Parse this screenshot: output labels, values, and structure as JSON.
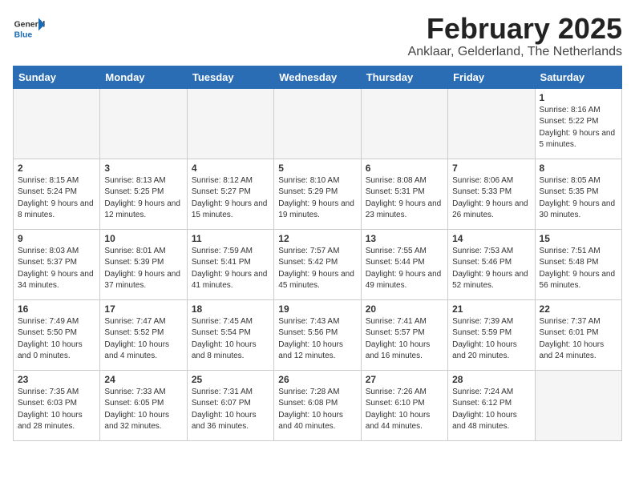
{
  "header": {
    "logo_general": "General",
    "logo_blue": "Blue",
    "month": "February 2025",
    "location": "Anklaar, Gelderland, The Netherlands"
  },
  "weekdays": [
    "Sunday",
    "Monday",
    "Tuesday",
    "Wednesday",
    "Thursday",
    "Friday",
    "Saturday"
  ],
  "weeks": [
    [
      {
        "day": "",
        "info": ""
      },
      {
        "day": "",
        "info": ""
      },
      {
        "day": "",
        "info": ""
      },
      {
        "day": "",
        "info": ""
      },
      {
        "day": "",
        "info": ""
      },
      {
        "day": "",
        "info": ""
      },
      {
        "day": "1",
        "info": "Sunrise: 8:16 AM\nSunset: 5:22 PM\nDaylight: 9 hours and 5 minutes."
      }
    ],
    [
      {
        "day": "2",
        "info": "Sunrise: 8:15 AM\nSunset: 5:24 PM\nDaylight: 9 hours and 8 minutes."
      },
      {
        "day": "3",
        "info": "Sunrise: 8:13 AM\nSunset: 5:25 PM\nDaylight: 9 hours and 12 minutes."
      },
      {
        "day": "4",
        "info": "Sunrise: 8:12 AM\nSunset: 5:27 PM\nDaylight: 9 hours and 15 minutes."
      },
      {
        "day": "5",
        "info": "Sunrise: 8:10 AM\nSunset: 5:29 PM\nDaylight: 9 hours and 19 minutes."
      },
      {
        "day": "6",
        "info": "Sunrise: 8:08 AM\nSunset: 5:31 PM\nDaylight: 9 hours and 23 minutes."
      },
      {
        "day": "7",
        "info": "Sunrise: 8:06 AM\nSunset: 5:33 PM\nDaylight: 9 hours and 26 minutes."
      },
      {
        "day": "8",
        "info": "Sunrise: 8:05 AM\nSunset: 5:35 PM\nDaylight: 9 hours and 30 minutes."
      }
    ],
    [
      {
        "day": "9",
        "info": "Sunrise: 8:03 AM\nSunset: 5:37 PM\nDaylight: 9 hours and 34 minutes."
      },
      {
        "day": "10",
        "info": "Sunrise: 8:01 AM\nSunset: 5:39 PM\nDaylight: 9 hours and 37 minutes."
      },
      {
        "day": "11",
        "info": "Sunrise: 7:59 AM\nSunset: 5:41 PM\nDaylight: 9 hours and 41 minutes."
      },
      {
        "day": "12",
        "info": "Sunrise: 7:57 AM\nSunset: 5:42 PM\nDaylight: 9 hours and 45 minutes."
      },
      {
        "day": "13",
        "info": "Sunrise: 7:55 AM\nSunset: 5:44 PM\nDaylight: 9 hours and 49 minutes."
      },
      {
        "day": "14",
        "info": "Sunrise: 7:53 AM\nSunset: 5:46 PM\nDaylight: 9 hours and 52 minutes."
      },
      {
        "day": "15",
        "info": "Sunrise: 7:51 AM\nSunset: 5:48 PM\nDaylight: 9 hours and 56 minutes."
      }
    ],
    [
      {
        "day": "16",
        "info": "Sunrise: 7:49 AM\nSunset: 5:50 PM\nDaylight: 10 hours and 0 minutes."
      },
      {
        "day": "17",
        "info": "Sunrise: 7:47 AM\nSunset: 5:52 PM\nDaylight: 10 hours and 4 minutes."
      },
      {
        "day": "18",
        "info": "Sunrise: 7:45 AM\nSunset: 5:54 PM\nDaylight: 10 hours and 8 minutes."
      },
      {
        "day": "19",
        "info": "Sunrise: 7:43 AM\nSunset: 5:56 PM\nDaylight: 10 hours and 12 minutes."
      },
      {
        "day": "20",
        "info": "Sunrise: 7:41 AM\nSunset: 5:57 PM\nDaylight: 10 hours and 16 minutes."
      },
      {
        "day": "21",
        "info": "Sunrise: 7:39 AM\nSunset: 5:59 PM\nDaylight: 10 hours and 20 minutes."
      },
      {
        "day": "22",
        "info": "Sunrise: 7:37 AM\nSunset: 6:01 PM\nDaylight: 10 hours and 24 minutes."
      }
    ],
    [
      {
        "day": "23",
        "info": "Sunrise: 7:35 AM\nSunset: 6:03 PM\nDaylight: 10 hours and 28 minutes."
      },
      {
        "day": "24",
        "info": "Sunrise: 7:33 AM\nSunset: 6:05 PM\nDaylight: 10 hours and 32 minutes."
      },
      {
        "day": "25",
        "info": "Sunrise: 7:31 AM\nSunset: 6:07 PM\nDaylight: 10 hours and 36 minutes."
      },
      {
        "day": "26",
        "info": "Sunrise: 7:28 AM\nSunset: 6:08 PM\nDaylight: 10 hours and 40 minutes."
      },
      {
        "day": "27",
        "info": "Sunrise: 7:26 AM\nSunset: 6:10 PM\nDaylight: 10 hours and 44 minutes."
      },
      {
        "day": "28",
        "info": "Sunrise: 7:24 AM\nSunset: 6:12 PM\nDaylight: 10 hours and 48 minutes."
      },
      {
        "day": "",
        "info": ""
      }
    ]
  ]
}
